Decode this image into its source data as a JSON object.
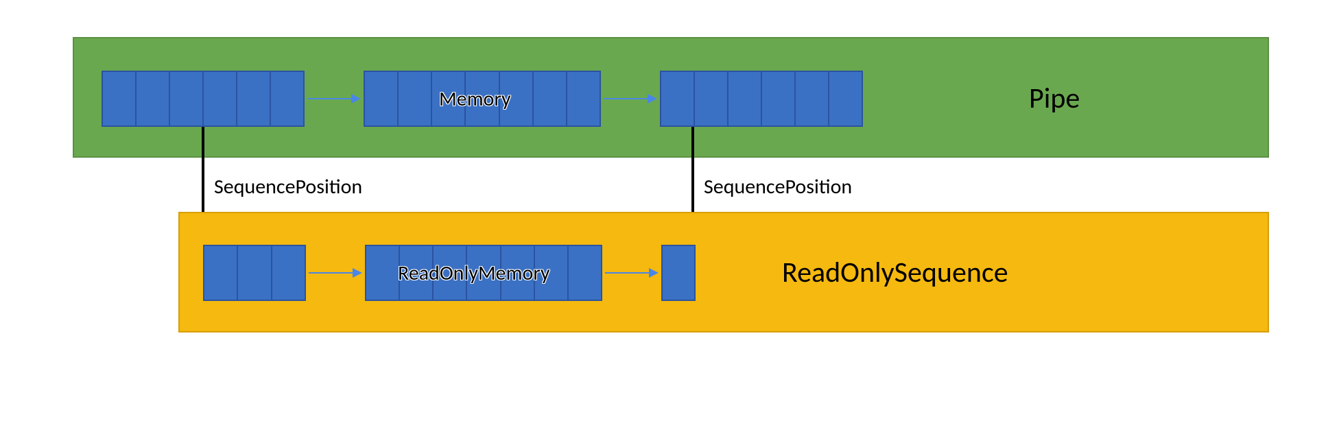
{
  "colors": {
    "pipe_bg": "#6aa84f",
    "sequence_bg": "#f5b90f",
    "block_fill": "#3b71c4",
    "block_border": "#2a53a0",
    "arrow": "#4a86e8",
    "connector": "#000000"
  },
  "top": {
    "title": "Pipe",
    "memory_label": "Memory",
    "blocks": [
      {
        "cells": 6
      },
      {
        "cells": 7
      },
      {
        "cells": 6
      }
    ]
  },
  "bottom": {
    "title": "ReadOnlySequence",
    "memory_label": "ReadOnlyMemory",
    "blocks": [
      {
        "cells": 3
      },
      {
        "cells": 7
      },
      {
        "cells": 1
      }
    ]
  },
  "connectors": {
    "left_label": "SequencePosition",
    "right_label": "SequencePosition"
  }
}
